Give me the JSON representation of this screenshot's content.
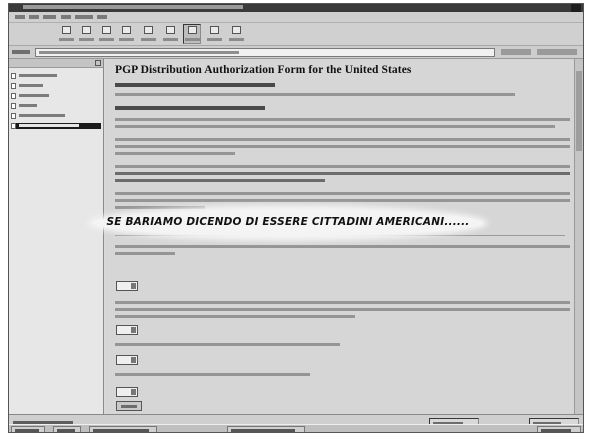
{
  "page": {
    "title": "PGP Distribution Authorization Form for the United States"
  },
  "overlay": {
    "caption": "SE BARIAMO DICENDO DI ESSERE CITTADINI AMERICANI......"
  },
  "colors": {
    "frame": "#d9d9d9",
    "content_background": "#d6d6d6",
    "title_bar": "#3a3a3a",
    "selected_item": "#1a1a1a",
    "overlay_background": "#f4f4f4"
  },
  "toolbar": {
    "buttons": [
      {
        "icon": "back-arrow-icon"
      },
      {
        "icon": "forward-arrow-icon"
      },
      {
        "icon": "reload-icon"
      },
      {
        "icon": "home-icon"
      },
      {
        "icon": "search-icon"
      },
      {
        "icon": "bookmarks-icon"
      },
      {
        "icon": "print-icon"
      },
      {
        "icon": "security-icon"
      },
      {
        "icon": "stop-icon"
      }
    ]
  }
}
